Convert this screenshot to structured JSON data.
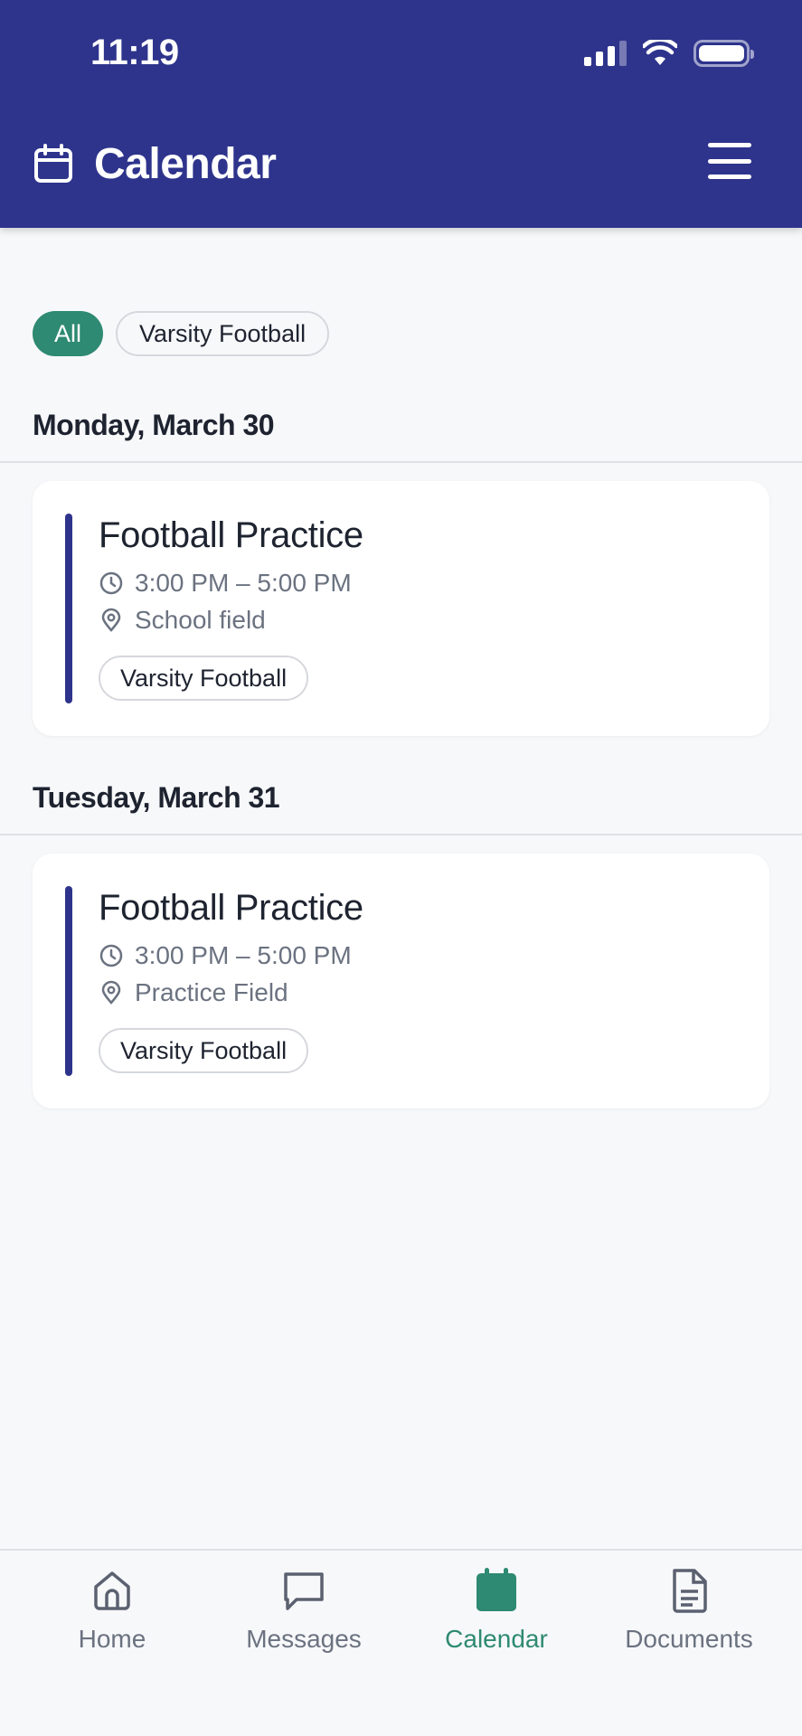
{
  "status_bar": {
    "time": "11:19"
  },
  "header": {
    "title": "Calendar",
    "title_icon": "calendar-icon",
    "menu_icon": "hamburger-menu-icon"
  },
  "filters": [
    {
      "label": "All",
      "active": true
    },
    {
      "label": "Varsity Football",
      "active": false
    }
  ],
  "days": [
    {
      "date_label": "Monday, March 30",
      "events": [
        {
          "title": "Football Practice",
          "time": "3:00 PM – 5:00 PM",
          "location": "School field",
          "tag": "Varsity Football"
        }
      ]
    },
    {
      "date_label": "Tuesday, March 31",
      "events": [
        {
          "title": "Football Practice",
          "time": "3:00 PM – 5:00 PM",
          "location": "Practice Field",
          "tag": "Varsity Football"
        }
      ]
    }
  ],
  "bottom_nav": [
    {
      "label": "Home",
      "icon": "home-icon",
      "active": false
    },
    {
      "label": "Messages",
      "icon": "message-icon",
      "active": false
    },
    {
      "label": "Calendar",
      "icon": "calendar-icon",
      "active": true
    },
    {
      "label": "Documents",
      "icon": "document-icon",
      "active": false
    }
  ],
  "colors": {
    "header_bg": "#2e348c",
    "accent_green": "#2e8a72",
    "event_bar": "#2e348c",
    "muted_text": "#6b7280"
  }
}
